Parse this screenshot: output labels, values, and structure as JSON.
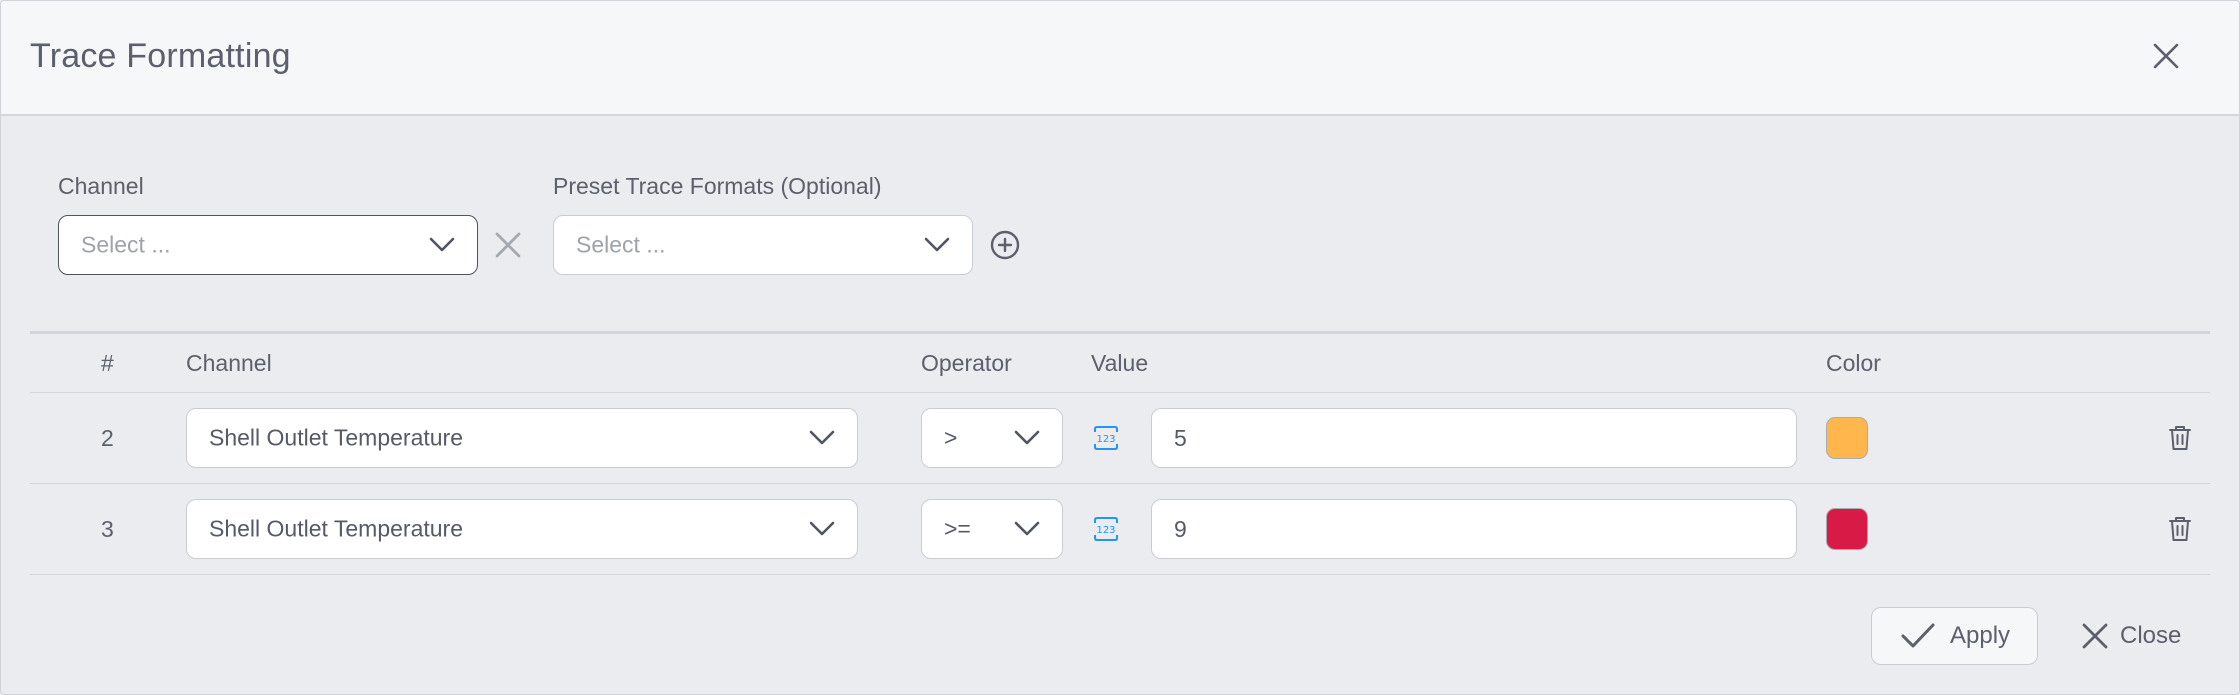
{
  "dialog": {
    "title": "Trace Formatting"
  },
  "filters": {
    "channel_label": "Channel",
    "channel_placeholder": "Select ...",
    "preset_label": "Preset Trace Formats (Optional)",
    "preset_placeholder": "Select ..."
  },
  "table": {
    "headers": {
      "number": "#",
      "channel": "Channel",
      "operator": "Operator",
      "value": "Value",
      "color": "Color"
    },
    "rows": [
      {
        "number": "2",
        "channel": "Shell Outlet Temperature",
        "operator": ">",
        "value": "5",
        "color": "#ffb74d"
      },
      {
        "number": "3",
        "channel": "Shell Outlet Temperature",
        "operator": ">=",
        "value": "9",
        "color": "#d81b46"
      }
    ]
  },
  "footer": {
    "apply_label": "Apply",
    "close_label": "Close"
  },
  "icons": {
    "header_close": "close-icon",
    "channel_clear": "clear-icon",
    "preset_add": "add-circle-icon",
    "value_type": "numeric-123-icon",
    "row_delete": "trash-icon",
    "apply": "check-icon",
    "close": "close-icon"
  },
  "colors": {
    "accent": "#2196f3",
    "header_bg": "#f6f7f9",
    "body_bg": "#ebecef"
  }
}
